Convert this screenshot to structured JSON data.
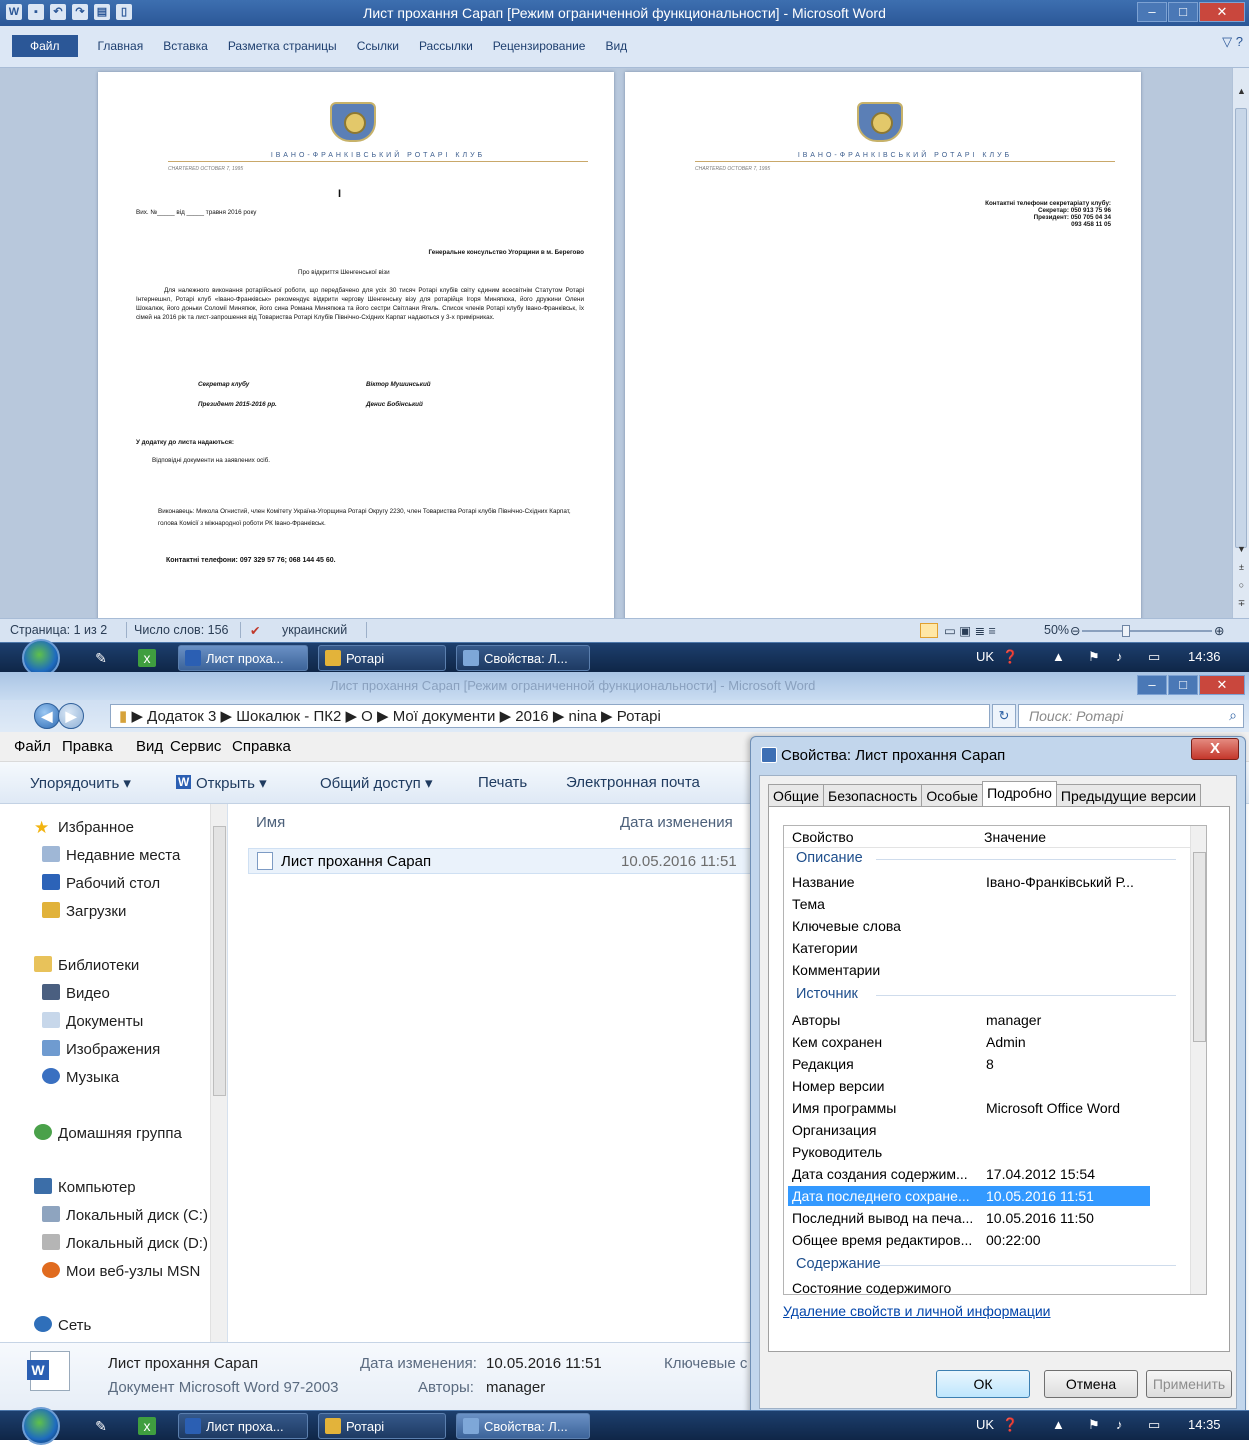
{
  "word": {
    "title": "Лист прохання Сарап [Режим ограниченной функциональности] - Microsoft Word",
    "file_tab": "Файл",
    "tabs": [
      "Главная",
      "Вставка",
      "Разметка страницы",
      "Ссылки",
      "Рассылки",
      "Рецензирование",
      "Вид"
    ],
    "page1": {
      "club": "ІВАНО-ФРАНКІВСЬКИЙ РОТАРІ КЛУБ",
      "chartered": "CHARTERED OCTOBER 7, 1995",
      "cursor": "I",
      "outgoing": "Вих. №_____ від _____ травня 2016 року",
      "addressee": "Генеральне консульство Угорщини в м. Берегово",
      "subject": "Про відкриття Шенгенської візи",
      "body": "Для належного виконання ротарійської роботи, що передбачено для усіх 30 тисяч Ротарі клубів світу єдиним всесвітнім Статутом Ротарі Інтернешнл, Ротарі клуб «Івано-Франківськ» рекомендує відкрити чергову Шенгенську візу для ротарійця Ігоря Миняпюка, його дружини Олени Шокалюк, його доньки Соломії Миняпюк, його сина Романа Миняпюка та його сестри Світлани Ягель. Список членів Ротарі клубу Івано-Франківськ, їх сімей на 2016 рік та лист-запрошення від Товариства Ротарі Клубів Північно-Східних Карпат надаються у 3-х примірниках.",
      "sig1_role": "Секретар клубу",
      "sig1_name": "Віктор Мушинський",
      "sig2_role": "Президент 2015-2016 рр.",
      "sig2_name": "Денис Бобінський",
      "attach_head": "У додатку до листа надаються:",
      "attach_text": "Відповідні документи на заявлених осіб.",
      "executor": "Виконавець: Микола Огнистий, член Комітету Україна-Угорщина Ротарі Округу 2230, член Товариства Ротарі клубів Північно-Східних Карпат, голова Комісії з міжнародної роботи РК Івано-Франківськ.",
      "phones": "Контактні телефони: 097 329 57 76; 068 144 45 60."
    },
    "page2": {
      "club": "ІВАНО-ФРАНКІВСЬКИЙ РОТАРІ КЛУБ",
      "chartered": "CHARTERED OCTOBER 7, 1995",
      "contacts_head": "Контактні телефони секретаріату клубу:",
      "secretary": "Секретар: 050 913 75 96",
      "president": "Президент: 050 705 04 34",
      "extra": "093 458 11 05"
    },
    "status": {
      "page": "Страница: 1 из 2",
      "words": "Число слов: 156",
      "lang": "украинский",
      "zoom": "50%"
    }
  },
  "taskbar_top": {
    "buttons": [
      "Лист проха...",
      "Ротарі",
      "Свойства: Л..."
    ],
    "lang": "UK",
    "time": "14:36"
  },
  "explorer": {
    "title_ghost": "Лист прохання Сарап [Режим ограниченной функциональности] - Microsoft Word",
    "path": "▶ Додаток 3 ▶ Шокалюк - ПК2 ▶ О ▶ Мої документи ▶ 2016 ▶ nina ▶ Ротарі",
    "search_placeholder": "Поиск: Ротарі",
    "menu": [
      "Файл",
      "Правка",
      "Вид",
      "Сервис",
      "Справка"
    ],
    "commands": [
      "Упорядочить ▾",
      "Открыть ▾",
      "Общий доступ ▾",
      "Печать",
      "Электронная почта"
    ],
    "nav": {
      "favorites": "Избранное",
      "recent": "Недавние места",
      "desktop": "Рабочий стол",
      "downloads": "Загрузки",
      "libraries": "Библиотеки",
      "video": "Видео",
      "documents": "Документы",
      "images": "Изображения",
      "music": "Музыка",
      "homegroup": "Домашняя группа",
      "computer": "Компьютер",
      "disk_c": "Локальный диск (C:)",
      "disk_d": "Локальный диск (D:)",
      "msn": "Мои веб-узлы MSN",
      "network": "Сеть"
    },
    "columns": {
      "name": "Имя",
      "date": "Дата изменения"
    },
    "file": {
      "name": "Лист прохання Сарап",
      "date": "10.05.2016 11:51"
    },
    "details": {
      "name": "Лист прохання Сарап",
      "type": "Документ Microsoft Word 97-2003",
      "date_label": "Дата изменения:",
      "date_value": "10.05.2016 11:51",
      "authors_label": "Авторы:",
      "authors_value": "manager",
      "keywords_label": "Ключевые с"
    }
  },
  "props": {
    "title": "Свойства: Лист прохання Сарап",
    "tabs": [
      "Общие",
      "Безопасность",
      "Особые",
      "Подробно",
      "Предыдущие версии"
    ],
    "col_prop": "Свойство",
    "col_val": "Значение",
    "groups": {
      "desc": "Описание",
      "src": "Источник",
      "content": "Содержание"
    },
    "rows": [
      [
        "Название",
        "Івано-Франківський Р..."
      ],
      [
        "Тема",
        ""
      ],
      [
        "Ключевые слова",
        ""
      ],
      [
        "Категории",
        ""
      ],
      [
        "Комментарии",
        ""
      ],
      [
        "Авторы",
        "manager"
      ],
      [
        "Кем сохранен",
        "Admin"
      ],
      [
        "Редакция",
        "8"
      ],
      [
        "Номер версии",
        ""
      ],
      [
        "Имя программы",
        "Microsoft Office Word"
      ],
      [
        "Организация",
        ""
      ],
      [
        "Руководитель",
        ""
      ],
      [
        "Дата создания содержим...",
        "17.04.2012 15:54"
      ],
      [
        "Дата последнего сохране...",
        "10.05.2016 11:51"
      ],
      [
        "Последний вывод на печа...",
        "10.05.2016 11:50"
      ],
      [
        "Общее время редактиров...",
        "00:22:00"
      ],
      [
        "Состояние содержимого",
        ""
      ]
    ],
    "link": "Удаление свойств и личной информации",
    "ok": "ОК",
    "cancel": "Отмена",
    "apply": "Применить"
  },
  "taskbar_bottom": {
    "buttons": [
      "Лист проха...",
      "Ротарі",
      "Свойства: Л..."
    ],
    "lang": "UK",
    "time": "14:35"
  }
}
